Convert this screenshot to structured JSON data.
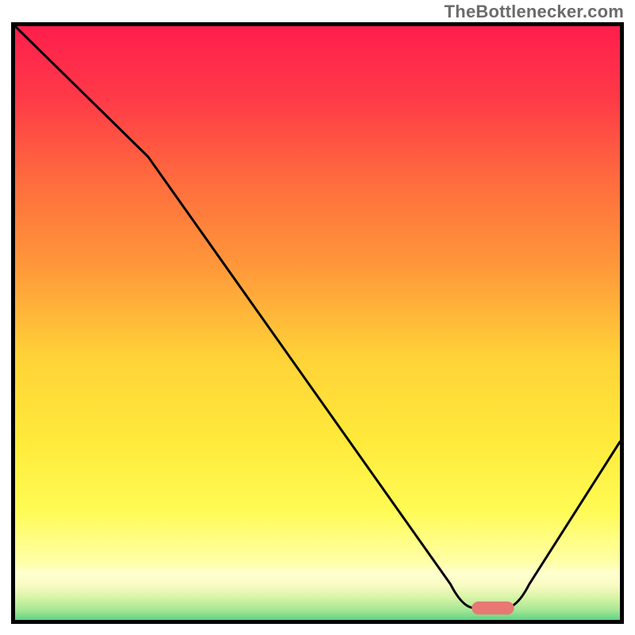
{
  "attribution": "TheBottlenecker.com",
  "chart_data": {
    "type": "line",
    "title": "",
    "xlabel": "",
    "ylabel": "",
    "xlim": [
      0,
      100
    ],
    "ylim": [
      0,
      100
    ],
    "series": [
      {
        "name": "bottleneck-curve",
        "x": [
          0,
          22,
          75,
          80,
          82,
          100
        ],
        "y": [
          100,
          78,
          2,
          2,
          2,
          30
        ]
      }
    ],
    "marker": {
      "name": "optimal-region",
      "x_center": 79,
      "y": 2,
      "width": 7,
      "color": "#e77873"
    },
    "background_gradient": {
      "stops": [
        {
          "pos": 0.0,
          "color": "#ff1e4c"
        },
        {
          "pos": 0.12,
          "color": "#ff3a48"
        },
        {
          "pos": 0.25,
          "color": "#ff6a3e"
        },
        {
          "pos": 0.4,
          "color": "#ff993a"
        },
        {
          "pos": 0.55,
          "color": "#ffd338"
        },
        {
          "pos": 0.68,
          "color": "#ffe93a"
        },
        {
          "pos": 0.8,
          "color": "#fffb54"
        },
        {
          "pos": 0.885,
          "color": "#ffffa6"
        },
        {
          "pos": 0.905,
          "color": "#ffffd0"
        },
        {
          "pos": 0.925,
          "color": "#f8fbc2"
        },
        {
          "pos": 0.945,
          "color": "#d7f3a6"
        },
        {
          "pos": 0.965,
          "color": "#a6e795"
        },
        {
          "pos": 0.982,
          "color": "#5fd383"
        },
        {
          "pos": 1.0,
          "color": "#1cc46f"
        }
      ]
    }
  }
}
